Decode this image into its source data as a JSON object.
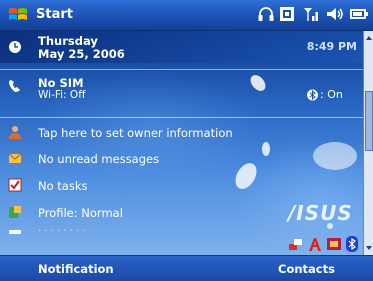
{
  "title_bar": {
    "start_label": "Start"
  },
  "today": {
    "date_line1": "Thursday",
    "date_line2": "May 25, 2006",
    "time": "8:49 PM",
    "phone_line1": "No SIM",
    "phone_line2": "Wi-Fi: Off",
    "bluetooth_status": ": On",
    "owner_info": "Tap here to set owner information",
    "messages": "No unread messages",
    "tasks": "No tasks",
    "profile": "Profile: Normal",
    "logo_text": "/ISUS"
  },
  "soft_keys": {
    "left": "Notification",
    "right": "Contacts"
  },
  "colors": {
    "title_bar": "#1a4fb0",
    "selection": "#0d2f73",
    "background": "#4f8ee0"
  }
}
